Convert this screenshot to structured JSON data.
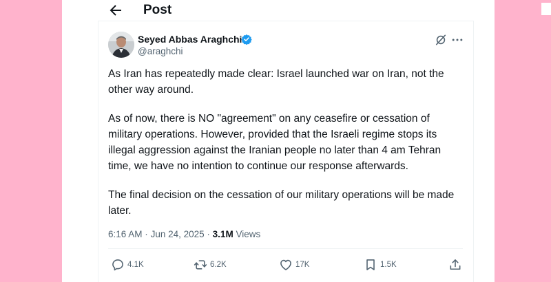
{
  "header": {
    "title": "Post",
    "back_icon": "arrow-left-icon"
  },
  "post": {
    "author_name": "Seyed Abbas Araghchi",
    "handle": "@araghchi",
    "verified": true,
    "paragraphs": [
      "As Iran has repeatedly made clear: Israel launched war on Iran, not the other way around.",
      "As of now, there is NO \"agreement\" on any ceasefire or cessation of military operations. However, provided that the Israeli regime stops its illegal aggression against the Iranian people no later than 4 am Tehran time, we have no intention to continue our response afterwards.",
      "The final decision on the cessation of our military operations will be made later."
    ],
    "time": "6:16 AM",
    "date": "Jun 24, 2025",
    "separator": "·",
    "views_count": "3.1M",
    "views_label": "Views"
  },
  "actions": {
    "replies": "4.1K",
    "reposts": "6.2K",
    "likes": "17K",
    "bookmarks": "1.5K"
  },
  "colors": {
    "background_pink": "#ffb3cc",
    "verified_blue": "#1d9bf0",
    "muted_text": "#536471",
    "primary_text": "#0f1419"
  }
}
